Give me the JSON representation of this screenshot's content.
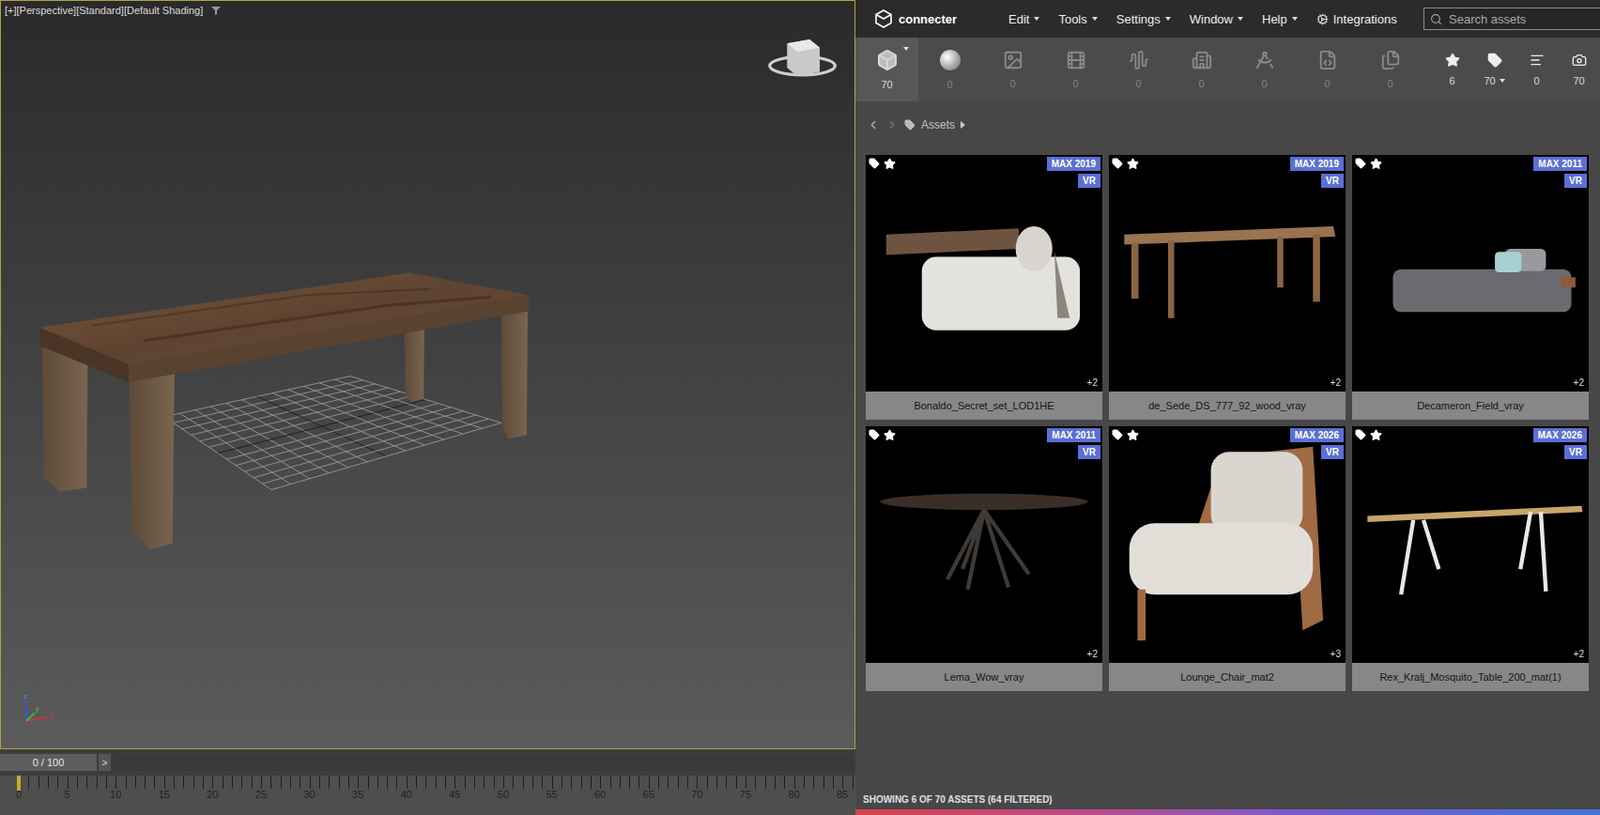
{
  "viewport": {
    "labels": [
      "[+]",
      "[Perspective]",
      "[Standard]",
      "[Default Shading]"
    ],
    "gizmo": [
      "x",
      "y",
      "z"
    ]
  },
  "timeline": {
    "frame": "0 / 100",
    "next": ">",
    "level": 0,
    "ticks": [
      "0",
      "5",
      "10",
      "15",
      "20",
      "25",
      "30",
      "35",
      "40",
      "45",
      "50",
      "55",
      "60",
      "65",
      "70",
      "75",
      "80",
      "85"
    ]
  },
  "header": {
    "logo": "connecter",
    "menus": [
      "Edit",
      "Tools",
      "Settings",
      "Window",
      "Help"
    ],
    "integrations": "Integrations",
    "search": {
      "placeholder": "Search assets"
    }
  },
  "categories": [
    {
      "count": "70",
      "selected": true,
      "dropdown": true
    },
    {
      "count": "0",
      "selected": false,
      "dropdown": false
    },
    {
      "count": "0",
      "selected": false,
      "dropdown": false
    },
    {
      "count": "0",
      "selected": false,
      "dropdown": false
    },
    {
      "count": "0",
      "selected": false,
      "dropdown": false
    },
    {
      "count": "0",
      "selected": false,
      "dropdown": false
    },
    {
      "count": "0",
      "selected": false,
      "dropdown": false
    },
    {
      "count": "0",
      "selected": false,
      "dropdown": false
    },
    {
      "count": "0",
      "selected": false,
      "dropdown": false
    }
  ],
  "filters": [
    {
      "count": "6",
      "dropdown": false
    },
    {
      "count": "70",
      "dropdown": true
    },
    {
      "count": "0",
      "dropdown": false
    },
    {
      "count": "70",
      "dropdown": false
    }
  ],
  "breadcrumb": {
    "label": "Assets"
  },
  "cards": [
    {
      "name": "Bonaldo_Secret_set_LOD1HE",
      "version": "MAX 2019",
      "renderer": "VR",
      "extra": "+2"
    },
    {
      "name": "de_Sede_DS_777_92_wood_vray",
      "version": "MAX 2019",
      "renderer": "VR",
      "extra": "+2"
    },
    {
      "name": "Decameron_Field_vray",
      "version": "MAX 2011",
      "renderer": "VR",
      "extra": "+2"
    },
    {
      "name": "Lema_Wow_vray",
      "version": "MAX 2011",
      "renderer": "VR",
      "extra": "+2"
    },
    {
      "name": "Lounge_Chair_mat2",
      "version": "MAX 2026",
      "renderer": "VR",
      "extra": "+3"
    },
    {
      "name": "Rex_Kralj_Mosquito_Table_200_mat(1)",
      "version": "MAX 2026",
      "renderer": "VR",
      "extra": "+2"
    }
  ],
  "status_bar": {
    "text": "SHOWING 6 OF 70 ASSETS (64 FILTERED)"
  }
}
